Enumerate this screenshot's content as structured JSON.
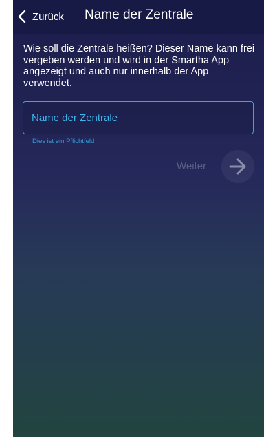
{
  "header": {
    "back_label": "Zurück",
    "title": "Name der Zentrale",
    "back_icon": "chevron-left-icon"
  },
  "main": {
    "description": "Wie soll die Zentrale heißen? Dieser Name kann frei vergeben werden und wird in der Smartha App angezeigt und auch nur innerhalb der App verwendet.",
    "name_field": {
      "placeholder": "Name der Zentrale",
      "value": "",
      "helper": "Dies ist ein Pflichtfeld"
    },
    "next": {
      "label": "Weiter",
      "icon": "arrow-right-icon"
    }
  },
  "colors": {
    "accent": "#33a8e0",
    "appbar": "#171a44",
    "background_top": "#1d1d4c",
    "background_bottom": "#22453f"
  }
}
